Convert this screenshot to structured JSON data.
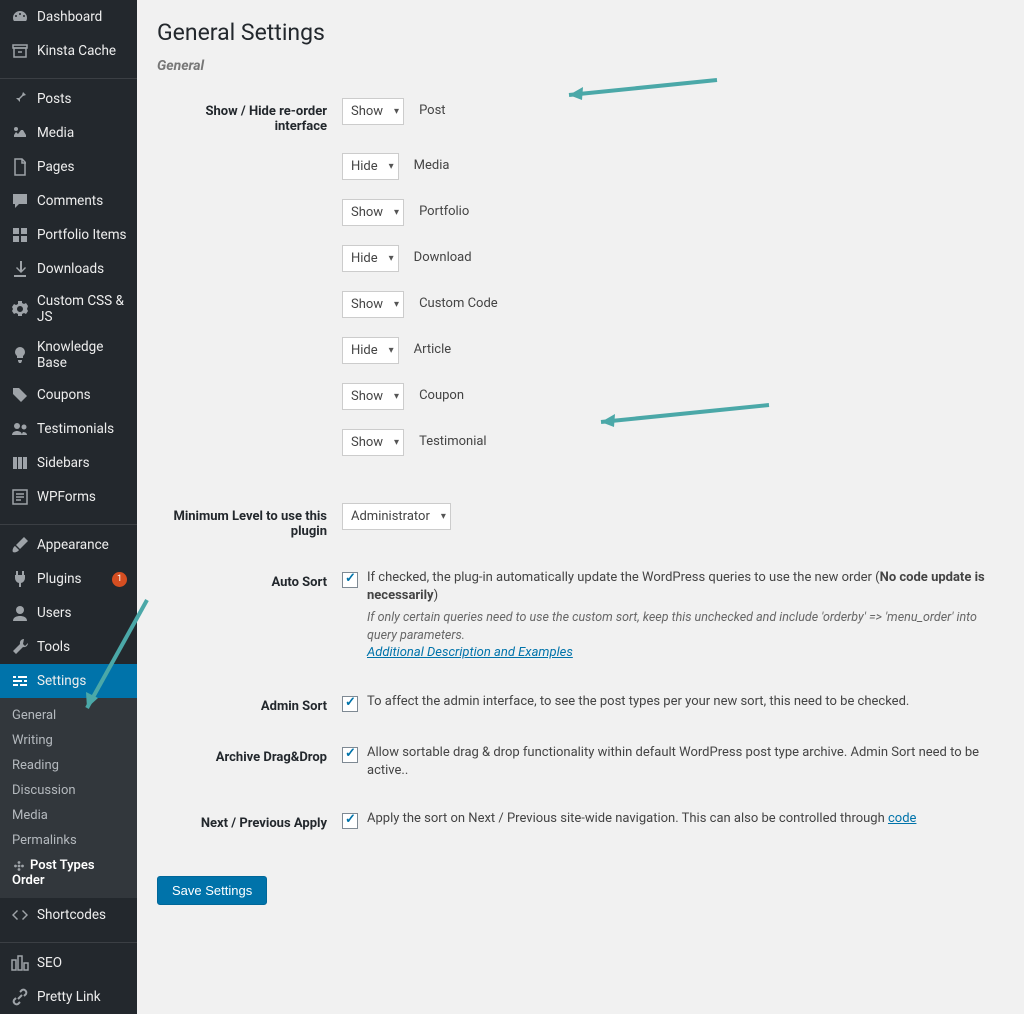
{
  "page": {
    "title": "General Settings",
    "section": "General",
    "saveLabel": "Save Settings"
  },
  "sidebar": {
    "items": [
      {
        "label": "Dashboard",
        "icon": "gauge"
      },
      {
        "label": "Kinsta Cache",
        "icon": "archive"
      },
      {
        "label": "Posts",
        "icon": "pin",
        "sep": true
      },
      {
        "label": "Media",
        "icon": "media"
      },
      {
        "label": "Pages",
        "icon": "page"
      },
      {
        "label": "Comments",
        "icon": "comment"
      },
      {
        "label": "Portfolio Items",
        "icon": "grid"
      },
      {
        "label": "Downloads",
        "icon": "download"
      },
      {
        "label": "Custom CSS & JS",
        "icon": "gear"
      },
      {
        "label": "Knowledge Base",
        "icon": "bulb"
      },
      {
        "label": "Coupons",
        "icon": "tag"
      },
      {
        "label": "Testimonials",
        "icon": "people"
      },
      {
        "label": "Sidebars",
        "icon": "columns"
      },
      {
        "label": "WPForms",
        "icon": "form"
      },
      {
        "label": "Appearance",
        "icon": "brush",
        "sep": true
      },
      {
        "label": "Plugins",
        "icon": "plug",
        "badge": "1"
      },
      {
        "label": "Users",
        "icon": "user"
      },
      {
        "label": "Tools",
        "icon": "wrench"
      },
      {
        "label": "Settings",
        "icon": "sliders",
        "active": true
      },
      {
        "label": "Shortcodes",
        "icon": "code"
      },
      {
        "label": "SEO",
        "icon": "seo",
        "sep": true
      },
      {
        "label": "Pretty Link",
        "icon": "link"
      }
    ],
    "submenu": [
      {
        "label": "General"
      },
      {
        "label": "Writing"
      },
      {
        "label": "Reading"
      },
      {
        "label": "Discussion"
      },
      {
        "label": "Media"
      },
      {
        "label": "Permalinks"
      },
      {
        "label": "Post Types Order",
        "current": true,
        "icon": "flower"
      }
    ]
  },
  "form": {
    "showHideLabel": "Show / Hide re-order interface",
    "postTypes": [
      {
        "value": "Show",
        "label": "Post"
      },
      {
        "value": "Hide",
        "label": "Media"
      },
      {
        "value": "Show",
        "label": "Portfolio"
      },
      {
        "value": "Hide",
        "label": "Download"
      },
      {
        "value": "Show",
        "label": "Custom Code"
      },
      {
        "value": "Hide",
        "label": "Article"
      },
      {
        "value": "Show",
        "label": "Coupon"
      },
      {
        "value": "Show",
        "label": "Testimonial"
      }
    ],
    "minLevelLabel": "Minimum Level to use this plugin",
    "minLevelValue": "Administrator",
    "autoSortLabel": "Auto Sort",
    "autoSortText1": "If checked, the plug-in automatically update the WordPress queries to use the new order (",
    "autoSortBold": "No code update is necessarily",
    "autoSortText2": ")",
    "autoSortEm": "If only certain queries need to use the custom sort, keep this unchecked and include 'orderby'  =>  'menu_order' into query parameters.",
    "autoSortLink": "Additional Description and Examples",
    "adminSortLabel": "Admin Sort",
    "adminSortText": "To affect the admin interface, to see the post types per your new sort, this need to be checked.",
    "archiveDragLabel": "Archive Drag&Drop",
    "archiveDragText": "Allow sortable drag & drop functionality within default WordPress post type archive. Admin Sort need to be active..",
    "nextPrevLabel": "Next / Previous Apply",
    "nextPrevText": "Apply the sort on Next / Previous site-wide navigation. This can also be controlled through ",
    "nextPrevLink": "code"
  }
}
